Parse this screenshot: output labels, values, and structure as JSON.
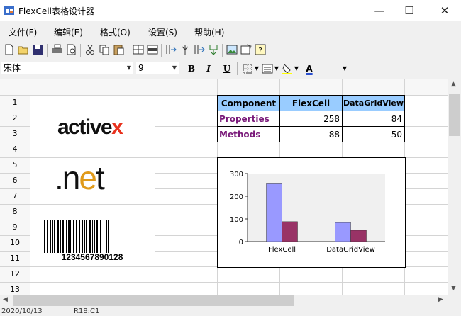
{
  "window": {
    "title": "FlexCell表格设计器",
    "minimize": "—",
    "maximize": "☐",
    "close": "✕"
  },
  "menu": [
    "文件(F)",
    "编辑(E)",
    "格式(O)",
    "设置(S)",
    "帮助(H)"
  ],
  "format": {
    "font_name": "宋体",
    "font_size": "9",
    "bold": "B",
    "italic": "I",
    "underline": "U",
    "font_color_letter": "A"
  },
  "grid": {
    "rows": [
      "1",
      "2",
      "3",
      "4",
      "5",
      "6",
      "7",
      "8",
      "9",
      "10",
      "11",
      "12",
      "13"
    ],
    "table": {
      "headers": [
        "Component",
        "FlexCell",
        "DataGridView"
      ],
      "rows": [
        {
          "label": "Properties",
          "flexcell": "258",
          "datagridview": "84"
        },
        {
          "label": "Methods",
          "flexcell": "88",
          "datagridview": "50"
        }
      ]
    },
    "logos": {
      "activex": "activex",
      "net": ".net",
      "barcode": "1234567890128"
    }
  },
  "chart_data": {
    "type": "bar",
    "categories": [
      "FlexCell",
      "DataGridView"
    ],
    "series": [
      {
        "values": [
          258,
          84
        ]
      },
      {
        "values": [
          88,
          50
        ]
      }
    ],
    "yticks": [
      "300",
      "200",
      "100",
      "0"
    ],
    "ylim": [
      0,
      300
    ],
    "colors": [
      "#9999ff",
      "#993366"
    ],
    "grid": false
  },
  "status": {
    "date": "2020/10/13",
    "cell": "R18:C1"
  }
}
